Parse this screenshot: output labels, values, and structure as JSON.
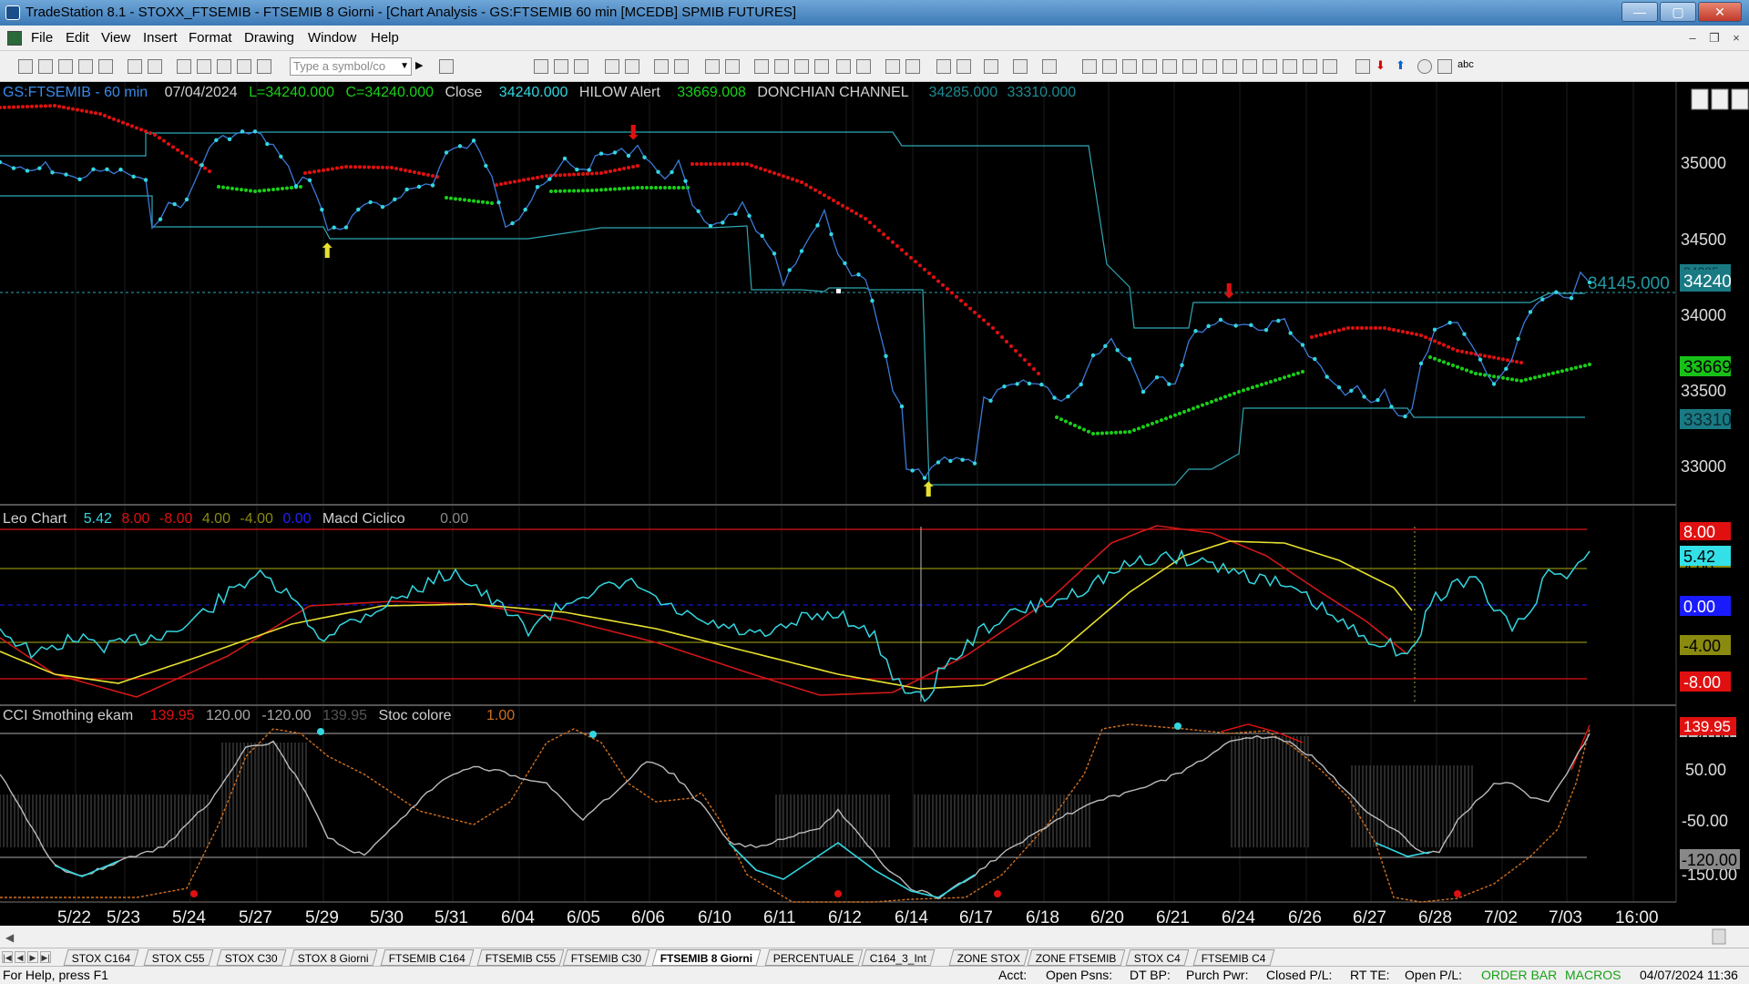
{
  "window": {
    "title": "TradeStation 8.1 - STOXX_FTSEMIB - FTSEMIB  8 Giorni - [Chart Analysis - GS:FTSEMIB  60 min  [MCEDB] SPMIB FUTURES]",
    "min": "—",
    "max": "▢",
    "close": "✕"
  },
  "menu": [
    "File",
    "Edit",
    "View",
    "Insert",
    "Format",
    "Drawing",
    "Window",
    "Help"
  ],
  "toolbar": {
    "symbol_placeholder": "Type a symbol/co"
  },
  "price_pane": {
    "symbol": "GS:FTSEMIB - 60 min",
    "date": "07/04/2024",
    "low": "L=34240.000",
    "close": "C=34240.000",
    "close_label": "Close",
    "close_value": "34240.000",
    "hilow_label": "HILOW Alert",
    "hilow_value": "33669.008",
    "donchian_label": "DONCHIAN CHANNEL",
    "donchian_upper": "34285.000",
    "donchian_lower": "33310.000",
    "last_price_label": "34145.000",
    "axis_ticks": [
      "35000",
      "34500",
      "34000",
      "33500",
      "33000"
    ],
    "tags": {
      "price": "34240",
      "hilow": "33669",
      "donch_low": "33310",
      "donch_up": "34285"
    }
  },
  "osc_pane": {
    "name": "Leo Chart",
    "v1": "5.42",
    "v2": "8.00",
    "v3": "-8.00",
    "v4": "4.00",
    "v5": "-4.00",
    "v6": "0.00",
    "name2": "Macd Ciclico",
    "v7": "0.00",
    "tags": {
      "t8": "8.00",
      "t542": "5.42",
      "t4": "4.00",
      "t0": "0.00",
      "tm4": "-4.00",
      "tm8": "-8.00"
    }
  },
  "cci_pane": {
    "name": "CCI Smothing ekam",
    "v1": "139.95",
    "v2": "120.00",
    "v3": "-120.00",
    "v4": "139.95",
    "name2": "Stoc colore",
    "v5": "1.00",
    "axis_ticks": [
      "50.00",
      "-50.00",
      "-150.00"
    ],
    "tags": {
      "t13995": "139.95",
      "t120": "120.00",
      "tm120": "-120.00"
    }
  },
  "x_axis": [
    "5/22",
    "5/23",
    "5/24",
    "5/27",
    "5/29",
    "5/30",
    "5/31",
    "6/04",
    "6/05",
    "6/06",
    "6/10",
    "6/11",
    "6/12",
    "6/14",
    "6/17",
    "6/18",
    "6/20",
    "6/21",
    "6/24",
    "6/26",
    "6/27",
    "6/28",
    "7/02",
    "7/03",
    "16:00"
  ],
  "tabs": [
    "STOX C164",
    "STOX C55",
    "STOX  C30",
    "STOX  8 Giorni",
    "FTSEMIB C164",
    "FTSEMIB C55",
    "FTSEMIB C30",
    "FTSEMIB  8 Giorni",
    "PERCENTUALE",
    "C164_3_Int",
    "ZONE STOX",
    "ZONE FTSEMIB",
    "STOX  C4",
    "FTSEMIB C4"
  ],
  "active_tab": "FTSEMIB  8 Giorni",
  "status": {
    "help": "For Help, press F1",
    "acct": "Acct:",
    "open_psns": "Open Psns:",
    "dt_bp": "DT BP:",
    "purch": "Purch Pwr:",
    "closed_pl": "Closed P/L:",
    "rt_te": "RT TE:",
    "open_pl": "Open P/L:",
    "order_bar": "ORDER BAR",
    "macros": "MACROS",
    "datetime": "04/07/2024 11:36"
  },
  "colors": {
    "cyan": "#33d6e0",
    "red": "#e01010",
    "green": "#18d018",
    "yellow": "#e8e030",
    "blue": "#1a1aff",
    "olive": "#8a8a10",
    "orange": "#d07020"
  }
}
